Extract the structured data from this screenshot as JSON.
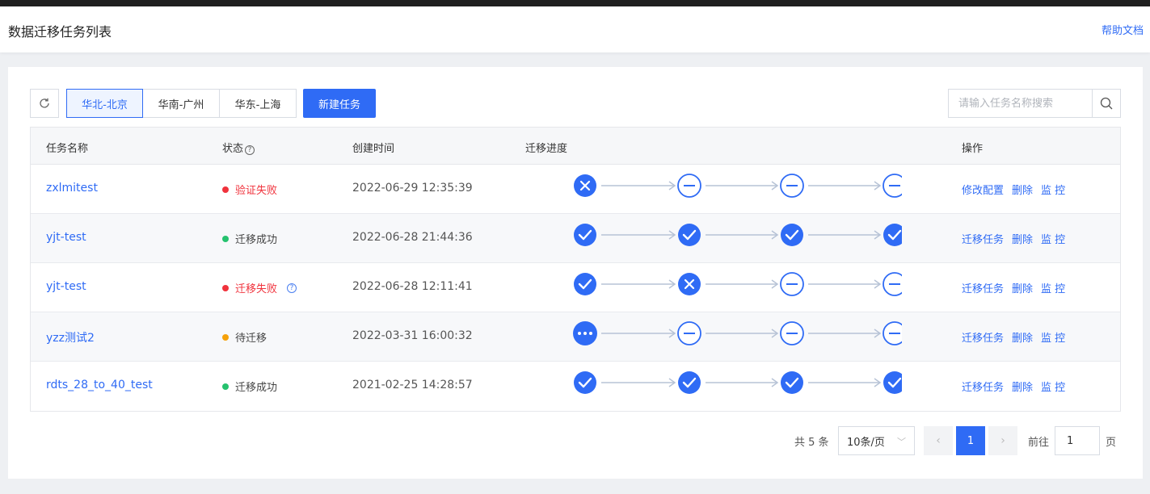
{
  "header": {
    "title": "数据迁移任务列表",
    "help_link": "帮助文档"
  },
  "toolbar": {
    "regions": [
      "华北-北京",
      "华南-广州",
      "华东-上海"
    ],
    "selected_region": "华北-北京",
    "new_task_label": "新建任务",
    "search_placeholder": "请输入任务名称搜索"
  },
  "table": {
    "columns": {
      "name": "任务名称",
      "status": "状态",
      "created": "创建时间",
      "progress": "迁移进度",
      "ops": "操作"
    },
    "rows": [
      {
        "name": "zxlmitest",
        "status": "验证失败",
        "status_type": "error",
        "created": "2022-06-29 12:35:39",
        "steps": [
          "fail",
          "pending",
          "pending",
          "pending"
        ],
        "ops": [
          "修改配置",
          "删除",
          "监 控"
        ],
        "help": false
      },
      {
        "name": "yjt-test",
        "status": "迁移成功",
        "status_type": "success",
        "created": "2022-06-28 21:44:36",
        "steps": [
          "done",
          "done",
          "done",
          "done"
        ],
        "ops": [
          "迁移任务",
          "删除",
          "监 控"
        ],
        "help": false
      },
      {
        "name": "yjt-test",
        "status": "迁移失败",
        "status_type": "error",
        "created": "2022-06-28 12:11:41",
        "steps": [
          "done",
          "fail",
          "pending",
          "pending"
        ],
        "ops": [
          "迁移任务",
          "删除",
          "监 控"
        ],
        "help": true
      },
      {
        "name": "yzz测试2",
        "status": "待迁移",
        "status_type": "waiting",
        "created": "2022-03-31 16:00:32",
        "steps": [
          "running",
          "pending",
          "pending",
          "pending"
        ],
        "ops": [
          "迁移任务",
          "删除",
          "监 控"
        ],
        "help": false
      },
      {
        "name": "rdts_28_to_40_test",
        "status": "迁移成功",
        "status_type": "success",
        "created": "2021-02-25 14:28:57",
        "steps": [
          "done",
          "done",
          "done",
          "done"
        ],
        "ops": [
          "迁移任务",
          "删除",
          "监 控"
        ],
        "help": false
      }
    ]
  },
  "colors": {
    "primary": "#2f6bf5",
    "error": "#f0323c",
    "success": "#25c26e",
    "waiting": "#f5a10a"
  },
  "pagination": {
    "total_text": "共 5 条",
    "page_size": "10条/页",
    "current_page": "1",
    "goto_label": "前往",
    "goto_value": "1",
    "page_suffix": "页"
  }
}
